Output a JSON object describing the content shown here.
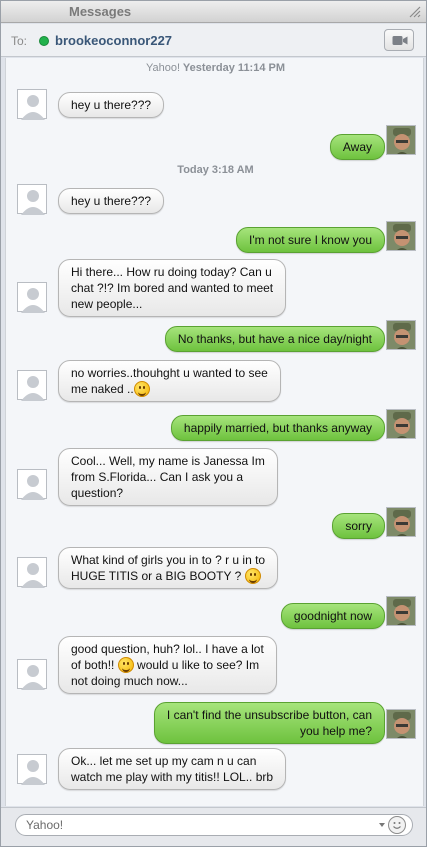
{
  "window": {
    "title": "Messages"
  },
  "header": {
    "to_label": "To:",
    "buddy": "brookeoconnor227",
    "status_color": "#22b24c"
  },
  "timestamps": [
    {
      "service": "Yahoo!",
      "time": "Yesterday 11:14 PM"
    },
    {
      "service": "",
      "time": "Today 3:18 AM"
    }
  ],
  "messages": [
    {
      "dir": "in",
      "lines": [
        "hey u there???"
      ]
    },
    {
      "dir": "out",
      "lines": [
        "Away"
      ]
    },
    {
      "dir": "in",
      "lines": [
        "hey u there???"
      ]
    },
    {
      "dir": "out",
      "lines": [
        "I'm not sure I know you"
      ]
    },
    {
      "dir": "in",
      "lines": [
        "Hi there... How ru doing today? Can u",
        "chat ?!? Im bored and wanted to meet",
        "new people..."
      ]
    },
    {
      "dir": "out",
      "lines": [
        "No thanks, but have a nice day/night"
      ]
    },
    {
      "dir": "in",
      "lines": [
        "no worries..thouhght u wanted to see",
        "me naked .."
      ]
    },
    {
      "dir": "out",
      "lines": [
        "happily married, but thanks anyway"
      ]
    },
    {
      "dir": "in",
      "lines": [
        "Cool... Well, my name is Janessa Im",
        "from S.Florida... Can I ask you a",
        "question?"
      ]
    },
    {
      "dir": "out",
      "lines": [
        "sorry"
      ]
    },
    {
      "dir": "in",
      "lines": [
        "What kind of girls you in to ? r u in to",
        "HUGE TITIS or a BIG BOOTY ?"
      ]
    },
    {
      "dir": "out",
      "lines": [
        "goodnight now"
      ]
    },
    {
      "dir": "in",
      "lines": [
        "good question, huh? lol.. I have a lot",
        "of both!!",
        " would u like to see? Im",
        "not doing much now..."
      ]
    },
    {
      "dir": "out",
      "lines": [
        "I can't find the unsubscribe button, can",
        "you help me?"
      ]
    },
    {
      "dir": "in",
      "lines": [
        "Ok... let me set up my cam n u can",
        "watch me play with my titis!! LOL.. brb"
      ]
    }
  ],
  "input": {
    "placeholder": "Yahoo!"
  },
  "colors": {
    "outgoing_bubble": "#8fd65a",
    "incoming_bubble": "#f5f5f5"
  },
  "icons": {
    "video": "video-camera-icon",
    "smiley": "smiley-icon",
    "resize": "resize-icon"
  }
}
